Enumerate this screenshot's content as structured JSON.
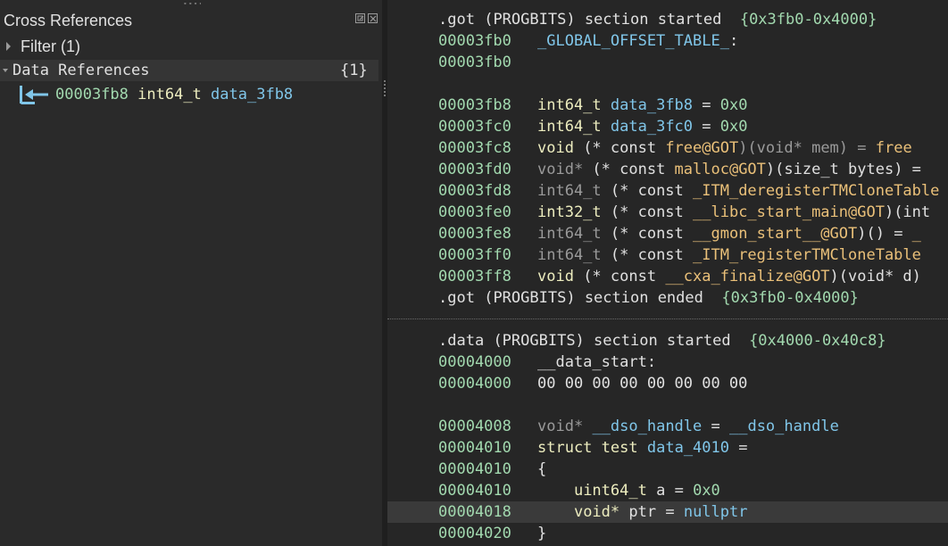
{
  "colors": {
    "background": "#262626",
    "panel": "#2a2a2a",
    "header_row": "#353535",
    "highlight_row": "#3a3a3a",
    "address": "#a2d9af",
    "symbol": "#80c6e9",
    "function": "#eac079",
    "type": "#ededbf",
    "text": "#e0e0e0",
    "dim": "#9a9a9a"
  },
  "xref": {
    "title": "Cross References",
    "detach_icon": "detach-icon",
    "close_icon": "close-icon",
    "filter_label": "Filter (1)",
    "data_refs_label": "Data References",
    "data_refs_count": "{1}",
    "item": {
      "icon": "data-reference-arrow-icon",
      "address": "00003fb8",
      "type": "int64_t",
      "name": "data_3fb8"
    }
  },
  "linear_view": {
    "got_start": {
      "name": ".got",
      "kind": "(PROGBITS)",
      "text": "section started",
      "range": "{0x3fb0-0x4000}"
    },
    "got_label": {
      "address": "00003fb0",
      "label": "_GLOBAL_OFFSET_TABLE_",
      "colon": ":"
    },
    "got_empty_address": "00003fb0",
    "got_entries": [
      {
        "address": "00003fb8",
        "type": "int64_t",
        "op": " ",
        "name": "data_3fb8",
        "rest": " = ",
        "value": "0x0"
      },
      {
        "address": "00003fc0",
        "type": "int64_t",
        "op": " ",
        "name": "data_3fc0",
        "rest": " = ",
        "value": "0x0"
      },
      {
        "address": "00003fc8",
        "type": "void",
        "op": " (* const ",
        "name": "free@GOT",
        "rest": ")(void* mem) = ",
        "value": "free"
      },
      {
        "address": "00003fd0",
        "type": "void*",
        "op": " (* const ",
        "name": "malloc@GOT",
        "rest": ")(size_t bytes) = ",
        "value": ""
      },
      {
        "address": "00003fd8",
        "type": "int64_t",
        "op": " (* const ",
        "name": "_ITM_deregisterTMCloneTable",
        "rest": "",
        "value": ""
      },
      {
        "address": "00003fe0",
        "type": "int32_t",
        "op": " (* const ",
        "name": "__libc_start_main@GOT",
        "rest": ")(int",
        "value": ""
      },
      {
        "address": "00003fe8",
        "type": "int64_t",
        "op": " (* const ",
        "name": "__gmon_start__@GOT",
        "rest": ")() = ",
        "value": "_"
      },
      {
        "address": "00003ff0",
        "type": "int64_t",
        "op": " (* const ",
        "name": "_ITM_registerTMCloneTable",
        "rest": "",
        "value": ""
      },
      {
        "address": "00003ff8",
        "type": "void",
        "op": " (* const ",
        "name": "__cxa_finalize@GOT",
        "rest": ")(void* d)",
        "value": ""
      }
    ],
    "got_end": {
      "name": ".got",
      "kind": "(PROGBITS)",
      "text": "section ended",
      "range": "{0x3fb0-0x4000}"
    },
    "data_start": {
      "name": ".data",
      "kind": "(PROGBITS)",
      "text": "section started",
      "range": "{0x4000-0x40c8}"
    },
    "data_label": {
      "address": "00004000",
      "label": "__data_start",
      "colon": ":"
    },
    "data_bytes": {
      "address": "00004000",
      "bytes": "00 00 00 00 00 00 00 00"
    },
    "dso": {
      "address": "00004008",
      "type": "void*",
      "name": "__dso_handle",
      "eq": " = ",
      "value": "__dso_handle"
    },
    "struct_decl": {
      "address": "00004010",
      "kw": "struct",
      "type": "test",
      "name": "data_4010",
      "eq": " ="
    },
    "struct_open": {
      "address": "00004010",
      "brace": "{"
    },
    "field_a": {
      "address": "00004010",
      "type": "uint64_t",
      "name": "a",
      "eq": " = ",
      "value": "0x0"
    },
    "field_ptr": {
      "address": "00004018",
      "type": "void*",
      "name": "ptr",
      "eq": " = ",
      "value": "nullptr"
    },
    "struct_close": {
      "address": "00004020",
      "brace": "}"
    }
  }
}
